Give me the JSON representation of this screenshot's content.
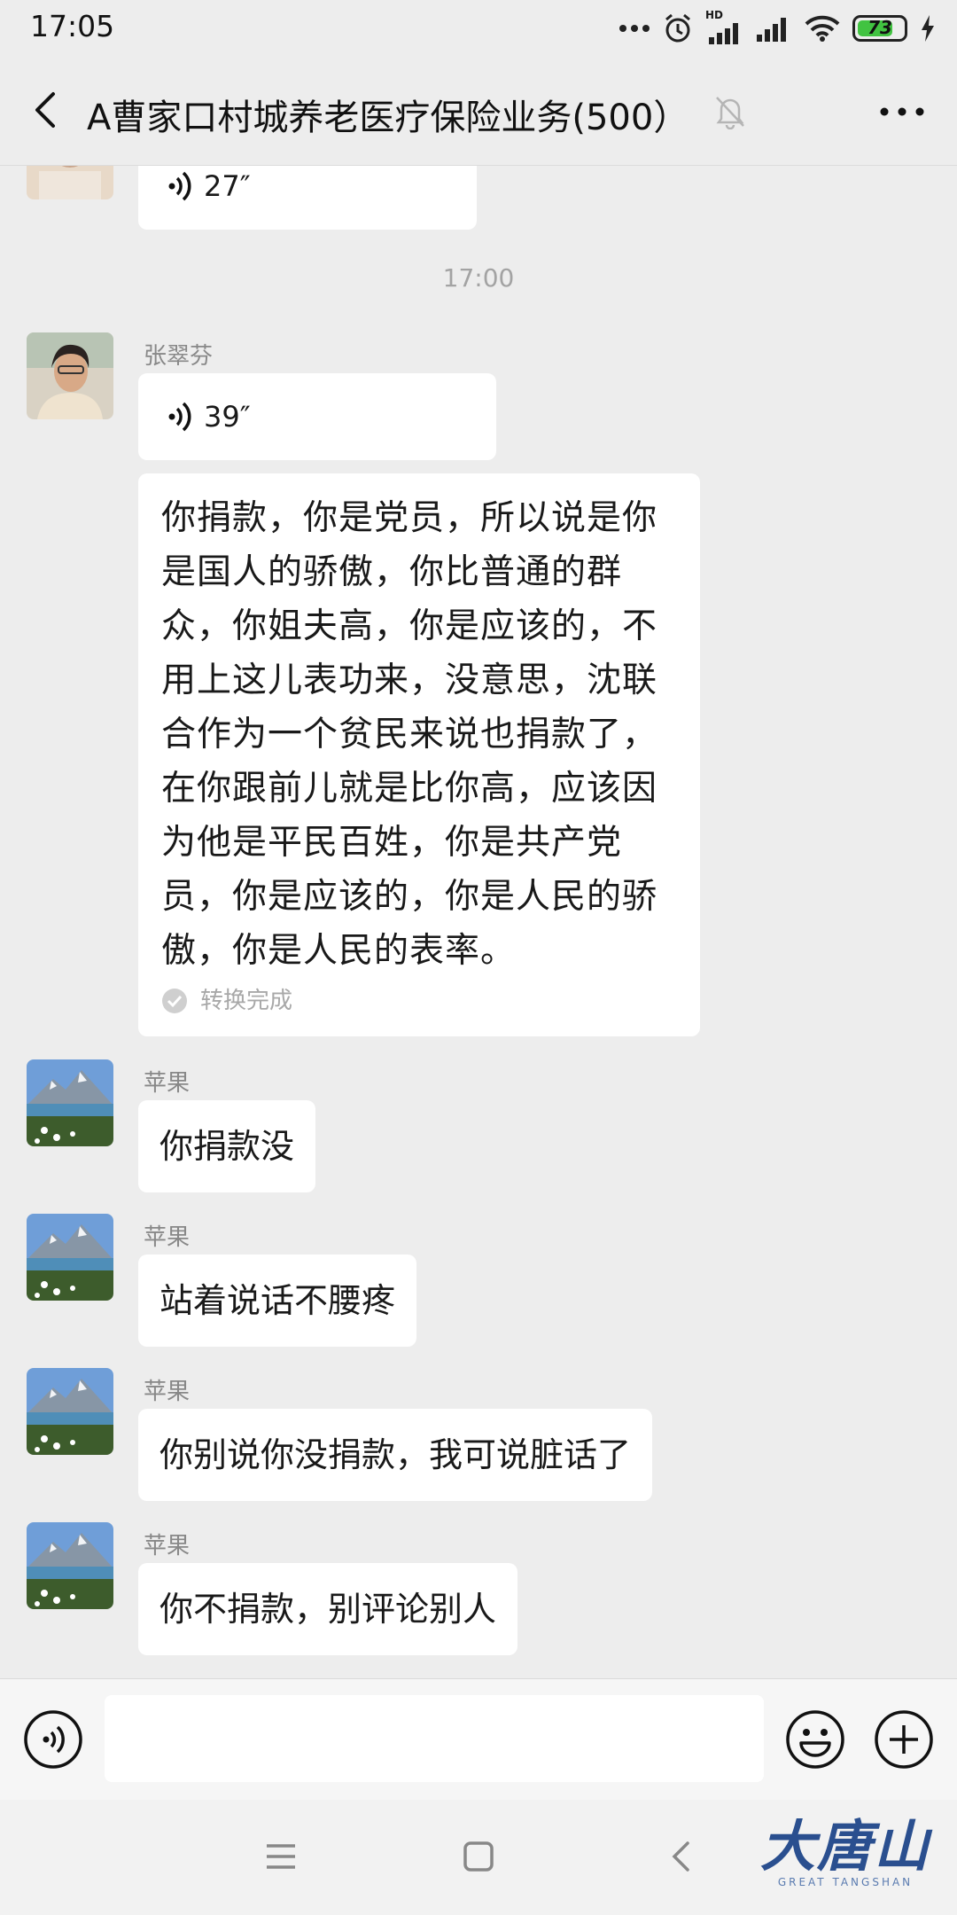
{
  "status_bar": {
    "time": "17:05",
    "battery": "73",
    "signal_label": "HD"
  },
  "header": {
    "title": "A曹家口村城养老医疗保险业务(500）"
  },
  "messages": {
    "m0_voice_duration": "27″",
    "time_divider": "17:00",
    "m1_sender": "张翠芬",
    "m1_voice_duration": "39″",
    "m1_transcript": "你捐款，你是党员，所以说是你是国人的骄傲，你比普通的群众，你姐夫高，你是应该的，不用上这儿表功来，没意思，沈联合作为一个贫民来说也捐款了，在你跟前儿就是比你高，应该因为他是平民百姓，你是共产党员，你是应该的，你是人民的骄傲，你是人民的表率。",
    "m1_transcript_status": "转换完成",
    "m2_sender": "苹果",
    "m2_text": "你捐款没",
    "m3_sender": "苹果",
    "m3_text": "站着说话不腰疼",
    "m4_sender": "苹果",
    "m4_text": "你别说你没捐款，我可说脏话了",
    "m5_sender": "苹果",
    "m5_text": "你不捐款，别评论别人"
  },
  "watermark": {
    "main": "大唐山",
    "sub": "GREAT TANGSHAN"
  },
  "colors": {
    "background": "#ededed",
    "bubble": "#ffffff",
    "sender": "#888888",
    "battery_fill": "#41c341",
    "watermark": "#2a4f8f"
  }
}
